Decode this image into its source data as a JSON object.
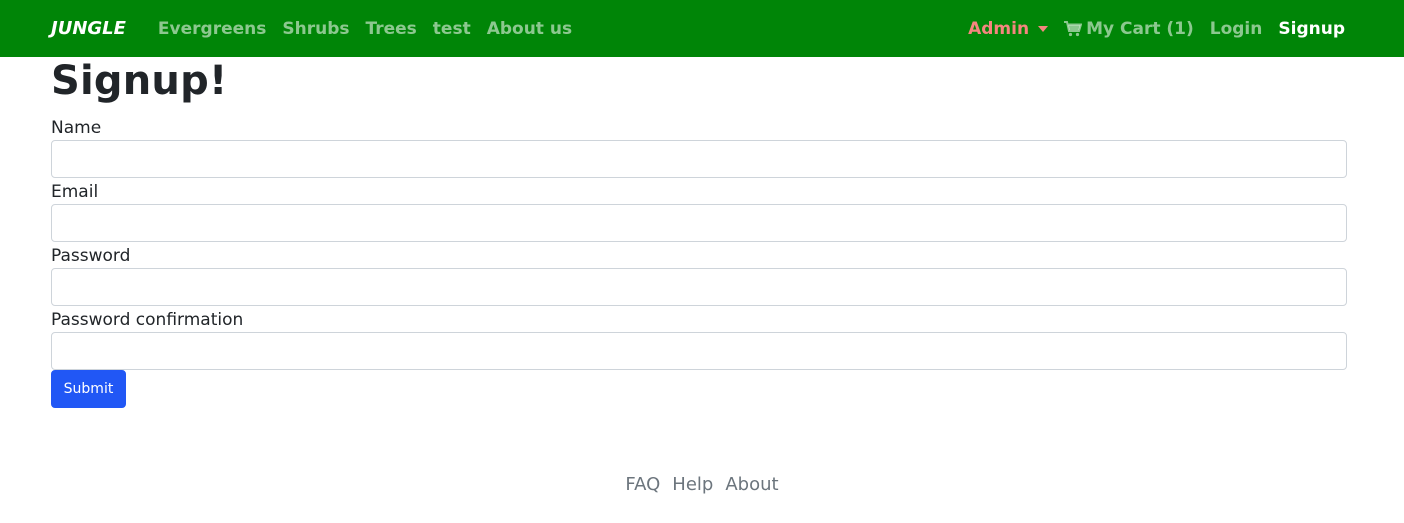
{
  "navbar": {
    "brand": "JUNGLE",
    "left_links": [
      {
        "label": "Evergreens"
      },
      {
        "label": "Shrubs"
      },
      {
        "label": "Trees"
      },
      {
        "label": "test"
      },
      {
        "label": "About us"
      }
    ],
    "admin_label": "Admin",
    "cart_label": "My Cart (1)",
    "cart_icon": "shopping-cart-icon",
    "login_label": "Login",
    "signup_label": "Signup",
    "colors": {
      "background": "#008507",
      "admin": "#f5867f",
      "active": "#ffffff"
    }
  },
  "form": {
    "title": "Signup!",
    "fields": [
      {
        "label": "Name",
        "value": "",
        "placeholder": ""
      },
      {
        "label": "Email",
        "value": "",
        "placeholder": ""
      },
      {
        "label": "Password",
        "value": "",
        "placeholder": ""
      },
      {
        "label": "Password confirmation",
        "value": "",
        "placeholder": ""
      }
    ],
    "submit_label": "Submit",
    "submit_color": "#2157f5"
  },
  "footer": {
    "links": [
      {
        "label": "FAQ"
      },
      {
        "label": "Help"
      },
      {
        "label": "About"
      }
    ]
  }
}
